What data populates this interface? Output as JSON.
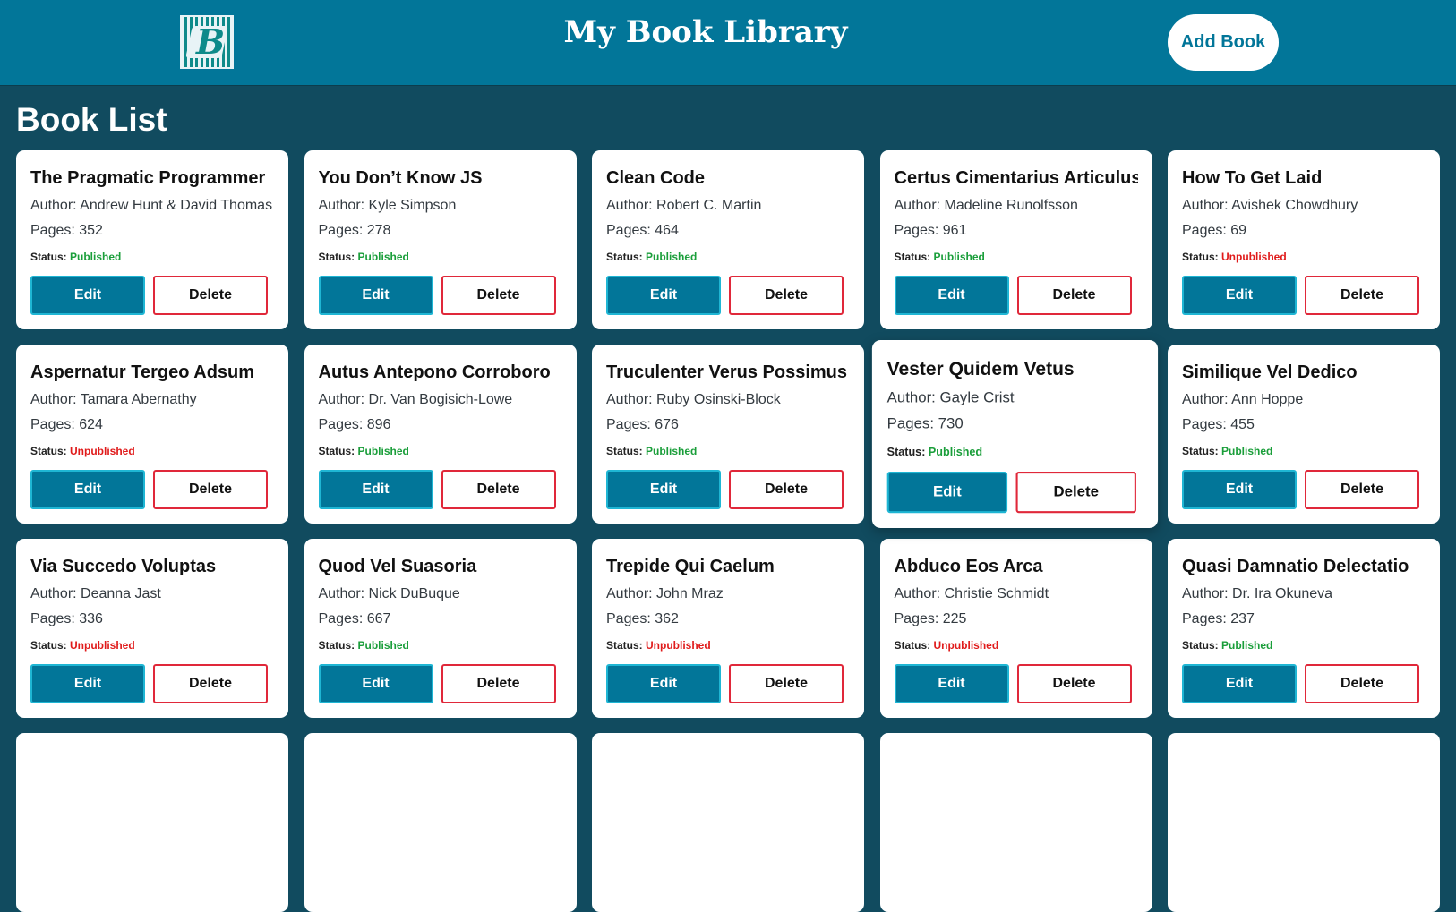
{
  "header": {
    "logo_letter": "B",
    "title": "My Book Library",
    "add_button": "Add Book"
  },
  "section_title": "Book List",
  "labels": {
    "author_prefix": "Author: ",
    "pages_prefix": "Pages: ",
    "status_prefix": "Status: ",
    "edit": "Edit",
    "delete": "Delete"
  },
  "colors": {
    "header_bg": "#027699",
    "page_bg": "#114b5f",
    "published": "#1a9e3a",
    "unpublished": "#e01b1b"
  },
  "books": [
    {
      "title": "The Pragmatic Programmer",
      "author": "Andrew Hunt & David Thomas",
      "pages": 352,
      "status": "Published"
    },
    {
      "title": "You Don’t Know JS",
      "author": "Kyle Simpson",
      "pages": 278,
      "status": "Published"
    },
    {
      "title": "Clean Code",
      "author": "Robert C. Martin",
      "pages": 464,
      "status": "Published"
    },
    {
      "title": "Certus Cimentarius Articulus",
      "author": "Madeline Runolfsson",
      "pages": 961,
      "status": "Published"
    },
    {
      "title": "How To Get Laid",
      "author": "Avishek Chowdhury",
      "pages": 69,
      "status": "Unpublished"
    },
    {
      "title": "Aspernatur Tergeo Adsum",
      "author": "Tamara Abernathy",
      "pages": 624,
      "status": "Unpublished"
    },
    {
      "title": "Autus Antepono Corroboro",
      "author": "Dr. Van Bogisich-Lowe",
      "pages": 896,
      "status": "Published"
    },
    {
      "title": "Truculenter Verus Possimus",
      "author": "Ruby Osinski-Block",
      "pages": 676,
      "status": "Published"
    },
    {
      "title": "Vester Quidem Vetus",
      "author": "Gayle Crist",
      "pages": 730,
      "status": "Published",
      "hovered": true
    },
    {
      "title": "Similique Vel Dedico",
      "author": "Ann Hoppe",
      "pages": 455,
      "status": "Published"
    },
    {
      "title": "Via Succedo Voluptas",
      "author": "Deanna Jast",
      "pages": 336,
      "status": "Unpublished"
    },
    {
      "title": "Quod Vel Suasoria",
      "author": "Nick DuBuque",
      "pages": 667,
      "status": "Published"
    },
    {
      "title": "Trepide Qui Caelum",
      "author": "John Mraz",
      "pages": 362,
      "status": "Unpublished"
    },
    {
      "title": "Abduco Eos Arca",
      "author": "Christie Schmidt",
      "pages": 225,
      "status": "Unpublished"
    },
    {
      "title": "Quasi Damnatio Delectatio",
      "author": "Dr. Ira Okuneva",
      "pages": 237,
      "status": "Published"
    },
    {
      "title": "",
      "author": "",
      "pages": null,
      "status": ""
    },
    {
      "title": "",
      "author": "",
      "pages": null,
      "status": ""
    },
    {
      "title": "",
      "author": "",
      "pages": null,
      "status": ""
    },
    {
      "title": "",
      "author": "",
      "pages": null,
      "status": ""
    },
    {
      "title": "",
      "author": "",
      "pages": null,
      "status": ""
    }
  ]
}
